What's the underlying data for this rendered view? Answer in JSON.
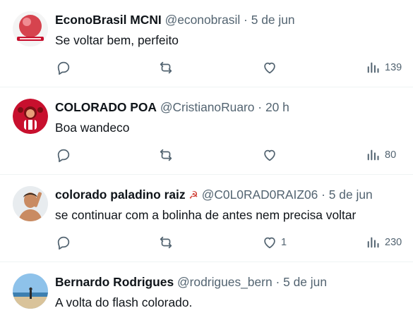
{
  "tweets": [
    {
      "name": "EconoBrasil MCNI",
      "emoji": "",
      "handle": "@econobrasil",
      "separator": "·",
      "date": "5 de jun",
      "text": "Se voltar bem, perfeito",
      "replies": "",
      "retweets": "",
      "likes": "",
      "views": "139",
      "avatar": "red-sphere-logo"
    },
    {
      "name": "COLORADO POA",
      "emoji": "",
      "handle": "@CristianoRuaro",
      "separator": "·",
      "date": "20 h",
      "text": "Boa wandeco",
      "replies": "",
      "retweets": "",
      "likes": "",
      "views": "80",
      "avatar": "red-mascot"
    },
    {
      "name": "colorado paladino raiz",
      "emoji": "☭",
      "handle": "@C0L0RAD0RAIZ06",
      "separator": "·",
      "date": "5 de jun",
      "text": "se continuar com a bolinha de antes nem precisa voltar",
      "replies": "",
      "retweets": "",
      "likes": "1",
      "views": "230",
      "avatar": "man-photo"
    },
    {
      "name": "Bernardo Rodrigues",
      "emoji": "",
      "handle": "@rodrigues_bern",
      "separator": "·",
      "date": "5 de jun",
      "text": "A volta do flash colorado.",
      "avatar": "beach-photo"
    }
  ],
  "icons": {
    "reply": "reply-icon",
    "retweet": "retweet-icon",
    "like": "heart-icon",
    "views": "views-icon"
  },
  "colors": {
    "text": "#0f1419",
    "muted": "#536471",
    "divider": "#eff3f4",
    "brand_red": "#c8102e"
  }
}
